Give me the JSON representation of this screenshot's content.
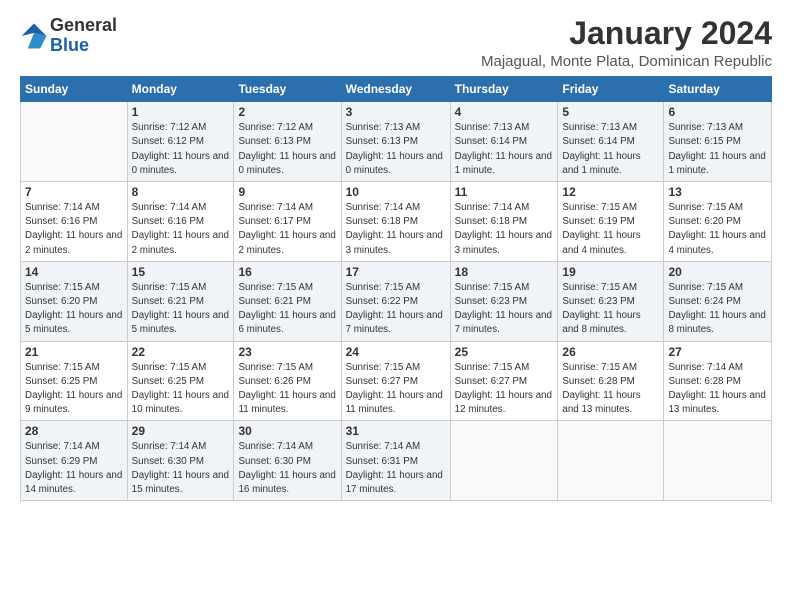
{
  "header": {
    "logo_general": "General",
    "logo_blue": "Blue",
    "month_title": "January 2024",
    "location": "Majagual, Monte Plata, Dominican Republic"
  },
  "days_of_week": [
    "Sunday",
    "Monday",
    "Tuesday",
    "Wednesday",
    "Thursday",
    "Friday",
    "Saturday"
  ],
  "weeks": [
    [
      {
        "day": "",
        "sunrise": "",
        "sunset": "",
        "daylight": ""
      },
      {
        "day": "1",
        "sunrise": "7:12 AM",
        "sunset": "6:12 PM",
        "daylight": "11 hours and 0 minutes."
      },
      {
        "day": "2",
        "sunrise": "7:12 AM",
        "sunset": "6:13 PM",
        "daylight": "11 hours and 0 minutes."
      },
      {
        "day": "3",
        "sunrise": "7:13 AM",
        "sunset": "6:13 PM",
        "daylight": "11 hours and 0 minutes."
      },
      {
        "day": "4",
        "sunrise": "7:13 AM",
        "sunset": "6:14 PM",
        "daylight": "11 hours and 1 minute."
      },
      {
        "day": "5",
        "sunrise": "7:13 AM",
        "sunset": "6:14 PM",
        "daylight": "11 hours and 1 minute."
      },
      {
        "day": "6",
        "sunrise": "7:13 AM",
        "sunset": "6:15 PM",
        "daylight": "11 hours and 1 minute."
      }
    ],
    [
      {
        "day": "7",
        "sunrise": "7:14 AM",
        "sunset": "6:16 PM",
        "daylight": "11 hours and 2 minutes."
      },
      {
        "day": "8",
        "sunrise": "7:14 AM",
        "sunset": "6:16 PM",
        "daylight": "11 hours and 2 minutes."
      },
      {
        "day": "9",
        "sunrise": "7:14 AM",
        "sunset": "6:17 PM",
        "daylight": "11 hours and 2 minutes."
      },
      {
        "day": "10",
        "sunrise": "7:14 AM",
        "sunset": "6:18 PM",
        "daylight": "11 hours and 3 minutes."
      },
      {
        "day": "11",
        "sunrise": "7:14 AM",
        "sunset": "6:18 PM",
        "daylight": "11 hours and 3 minutes."
      },
      {
        "day": "12",
        "sunrise": "7:15 AM",
        "sunset": "6:19 PM",
        "daylight": "11 hours and 4 minutes."
      },
      {
        "day": "13",
        "sunrise": "7:15 AM",
        "sunset": "6:20 PM",
        "daylight": "11 hours and 4 minutes."
      }
    ],
    [
      {
        "day": "14",
        "sunrise": "7:15 AM",
        "sunset": "6:20 PM",
        "daylight": "11 hours and 5 minutes."
      },
      {
        "day": "15",
        "sunrise": "7:15 AM",
        "sunset": "6:21 PM",
        "daylight": "11 hours and 5 minutes."
      },
      {
        "day": "16",
        "sunrise": "7:15 AM",
        "sunset": "6:21 PM",
        "daylight": "11 hours and 6 minutes."
      },
      {
        "day": "17",
        "sunrise": "7:15 AM",
        "sunset": "6:22 PM",
        "daylight": "11 hours and 7 minutes."
      },
      {
        "day": "18",
        "sunrise": "7:15 AM",
        "sunset": "6:23 PM",
        "daylight": "11 hours and 7 minutes."
      },
      {
        "day": "19",
        "sunrise": "7:15 AM",
        "sunset": "6:23 PM",
        "daylight": "11 hours and 8 minutes."
      },
      {
        "day": "20",
        "sunrise": "7:15 AM",
        "sunset": "6:24 PM",
        "daylight": "11 hours and 8 minutes."
      }
    ],
    [
      {
        "day": "21",
        "sunrise": "7:15 AM",
        "sunset": "6:25 PM",
        "daylight": "11 hours and 9 minutes."
      },
      {
        "day": "22",
        "sunrise": "7:15 AM",
        "sunset": "6:25 PM",
        "daylight": "11 hours and 10 minutes."
      },
      {
        "day": "23",
        "sunrise": "7:15 AM",
        "sunset": "6:26 PM",
        "daylight": "11 hours and 11 minutes."
      },
      {
        "day": "24",
        "sunrise": "7:15 AM",
        "sunset": "6:27 PM",
        "daylight": "11 hours and 11 minutes."
      },
      {
        "day": "25",
        "sunrise": "7:15 AM",
        "sunset": "6:27 PM",
        "daylight": "11 hours and 12 minutes."
      },
      {
        "day": "26",
        "sunrise": "7:15 AM",
        "sunset": "6:28 PM",
        "daylight": "11 hours and 13 minutes."
      },
      {
        "day": "27",
        "sunrise": "7:14 AM",
        "sunset": "6:28 PM",
        "daylight": "11 hours and 13 minutes."
      }
    ],
    [
      {
        "day": "28",
        "sunrise": "7:14 AM",
        "sunset": "6:29 PM",
        "daylight": "11 hours and 14 minutes."
      },
      {
        "day": "29",
        "sunrise": "7:14 AM",
        "sunset": "6:30 PM",
        "daylight": "11 hours and 15 minutes."
      },
      {
        "day": "30",
        "sunrise": "7:14 AM",
        "sunset": "6:30 PM",
        "daylight": "11 hours and 16 minutes."
      },
      {
        "day": "31",
        "sunrise": "7:14 AM",
        "sunset": "6:31 PM",
        "daylight": "11 hours and 17 minutes."
      },
      {
        "day": "",
        "sunrise": "",
        "sunset": "",
        "daylight": ""
      },
      {
        "day": "",
        "sunrise": "",
        "sunset": "",
        "daylight": ""
      },
      {
        "day": "",
        "sunrise": "",
        "sunset": "",
        "daylight": ""
      }
    ]
  ],
  "labels": {
    "sunrise": "Sunrise:",
    "sunset": "Sunset:",
    "daylight": "Daylight:"
  }
}
